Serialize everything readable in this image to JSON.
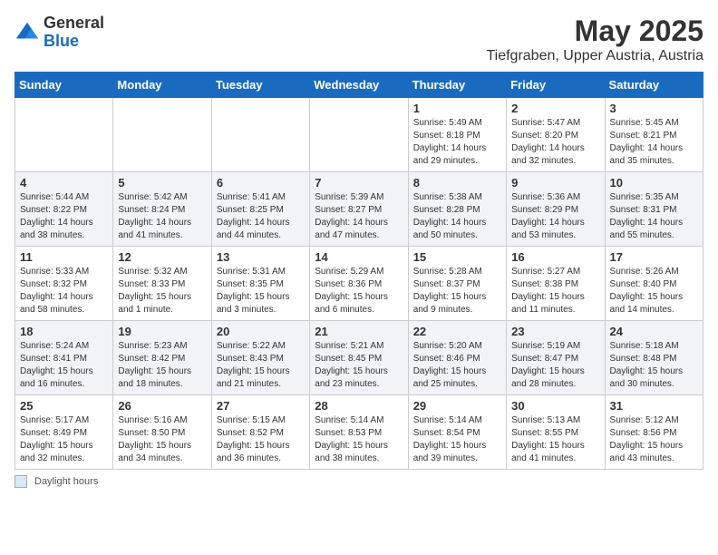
{
  "logo": {
    "general": "General",
    "blue": "Blue"
  },
  "header": {
    "month_year": "May 2025",
    "location": "Tiefgraben, Upper Austria, Austria"
  },
  "days_of_week": [
    "Sunday",
    "Monday",
    "Tuesday",
    "Wednesday",
    "Thursday",
    "Friday",
    "Saturday"
  ],
  "weeks": [
    [
      {
        "day": "",
        "content": ""
      },
      {
        "day": "",
        "content": ""
      },
      {
        "day": "",
        "content": ""
      },
      {
        "day": "",
        "content": ""
      },
      {
        "day": "1",
        "content": "Sunrise: 5:49 AM\nSunset: 8:18 PM\nDaylight: 14 hours\nand 29 minutes."
      },
      {
        "day": "2",
        "content": "Sunrise: 5:47 AM\nSunset: 8:20 PM\nDaylight: 14 hours\nand 32 minutes."
      },
      {
        "day": "3",
        "content": "Sunrise: 5:45 AM\nSunset: 8:21 PM\nDaylight: 14 hours\nand 35 minutes."
      }
    ],
    [
      {
        "day": "4",
        "content": "Sunrise: 5:44 AM\nSunset: 8:22 PM\nDaylight: 14 hours\nand 38 minutes."
      },
      {
        "day": "5",
        "content": "Sunrise: 5:42 AM\nSunset: 8:24 PM\nDaylight: 14 hours\nand 41 minutes."
      },
      {
        "day": "6",
        "content": "Sunrise: 5:41 AM\nSunset: 8:25 PM\nDaylight: 14 hours\nand 44 minutes."
      },
      {
        "day": "7",
        "content": "Sunrise: 5:39 AM\nSunset: 8:27 PM\nDaylight: 14 hours\nand 47 minutes."
      },
      {
        "day": "8",
        "content": "Sunrise: 5:38 AM\nSunset: 8:28 PM\nDaylight: 14 hours\nand 50 minutes."
      },
      {
        "day": "9",
        "content": "Sunrise: 5:36 AM\nSunset: 8:29 PM\nDaylight: 14 hours\nand 53 minutes."
      },
      {
        "day": "10",
        "content": "Sunrise: 5:35 AM\nSunset: 8:31 PM\nDaylight: 14 hours\nand 55 minutes."
      }
    ],
    [
      {
        "day": "11",
        "content": "Sunrise: 5:33 AM\nSunset: 8:32 PM\nDaylight: 14 hours\nand 58 minutes."
      },
      {
        "day": "12",
        "content": "Sunrise: 5:32 AM\nSunset: 8:33 PM\nDaylight: 15 hours\nand 1 minute."
      },
      {
        "day": "13",
        "content": "Sunrise: 5:31 AM\nSunset: 8:35 PM\nDaylight: 15 hours\nand 3 minutes."
      },
      {
        "day": "14",
        "content": "Sunrise: 5:29 AM\nSunset: 8:36 PM\nDaylight: 15 hours\nand 6 minutes."
      },
      {
        "day": "15",
        "content": "Sunrise: 5:28 AM\nSunset: 8:37 PM\nDaylight: 15 hours\nand 9 minutes."
      },
      {
        "day": "16",
        "content": "Sunrise: 5:27 AM\nSunset: 8:38 PM\nDaylight: 15 hours\nand 11 minutes."
      },
      {
        "day": "17",
        "content": "Sunrise: 5:26 AM\nSunset: 8:40 PM\nDaylight: 15 hours\nand 14 minutes."
      }
    ],
    [
      {
        "day": "18",
        "content": "Sunrise: 5:24 AM\nSunset: 8:41 PM\nDaylight: 15 hours\nand 16 minutes."
      },
      {
        "day": "19",
        "content": "Sunrise: 5:23 AM\nSunset: 8:42 PM\nDaylight: 15 hours\nand 18 minutes."
      },
      {
        "day": "20",
        "content": "Sunrise: 5:22 AM\nSunset: 8:43 PM\nDaylight: 15 hours\nand 21 minutes."
      },
      {
        "day": "21",
        "content": "Sunrise: 5:21 AM\nSunset: 8:45 PM\nDaylight: 15 hours\nand 23 minutes."
      },
      {
        "day": "22",
        "content": "Sunrise: 5:20 AM\nSunset: 8:46 PM\nDaylight: 15 hours\nand 25 minutes."
      },
      {
        "day": "23",
        "content": "Sunrise: 5:19 AM\nSunset: 8:47 PM\nDaylight: 15 hours\nand 28 minutes."
      },
      {
        "day": "24",
        "content": "Sunrise: 5:18 AM\nSunset: 8:48 PM\nDaylight: 15 hours\nand 30 minutes."
      }
    ],
    [
      {
        "day": "25",
        "content": "Sunrise: 5:17 AM\nSunset: 8:49 PM\nDaylight: 15 hours\nand 32 minutes."
      },
      {
        "day": "26",
        "content": "Sunrise: 5:16 AM\nSunset: 8:50 PM\nDaylight: 15 hours\nand 34 minutes."
      },
      {
        "day": "27",
        "content": "Sunrise: 5:15 AM\nSunset: 8:52 PM\nDaylight: 15 hours\nand 36 minutes."
      },
      {
        "day": "28",
        "content": "Sunrise: 5:14 AM\nSunset: 8:53 PM\nDaylight: 15 hours\nand 38 minutes."
      },
      {
        "day": "29",
        "content": "Sunrise: 5:14 AM\nSunset: 8:54 PM\nDaylight: 15 hours\nand 39 minutes."
      },
      {
        "day": "30",
        "content": "Sunrise: 5:13 AM\nSunset: 8:55 PM\nDaylight: 15 hours\nand 41 minutes."
      },
      {
        "day": "31",
        "content": "Sunrise: 5:12 AM\nSunset: 8:56 PM\nDaylight: 15 hours\nand 43 minutes."
      }
    ]
  ],
  "footer": {
    "legend_label": "Daylight hours"
  }
}
